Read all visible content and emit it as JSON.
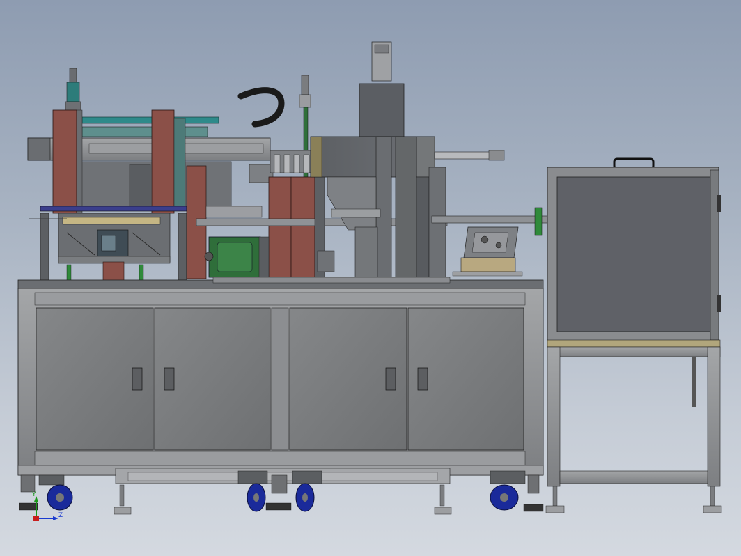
{
  "scene": {
    "colors": {
      "frame_gray": "#8f9194",
      "cabinet_gray": "#7c7e80",
      "dark_steel": "#55585c",
      "rust_panel": "#8b5048",
      "teal": "#2e8a8a",
      "green_motor": "#2f6e3a",
      "wheel_blue": "#1a2a9a",
      "navy_plate": "#3a3e8c",
      "background_top": "#8e9cb1",
      "background_bottom": "#d4d9e0"
    },
    "coordinate_triad": {
      "y_label": "Y",
      "z_label": "Z",
      "y_color": "#1a9a1a",
      "z_color": "#1a3ad0"
    }
  }
}
